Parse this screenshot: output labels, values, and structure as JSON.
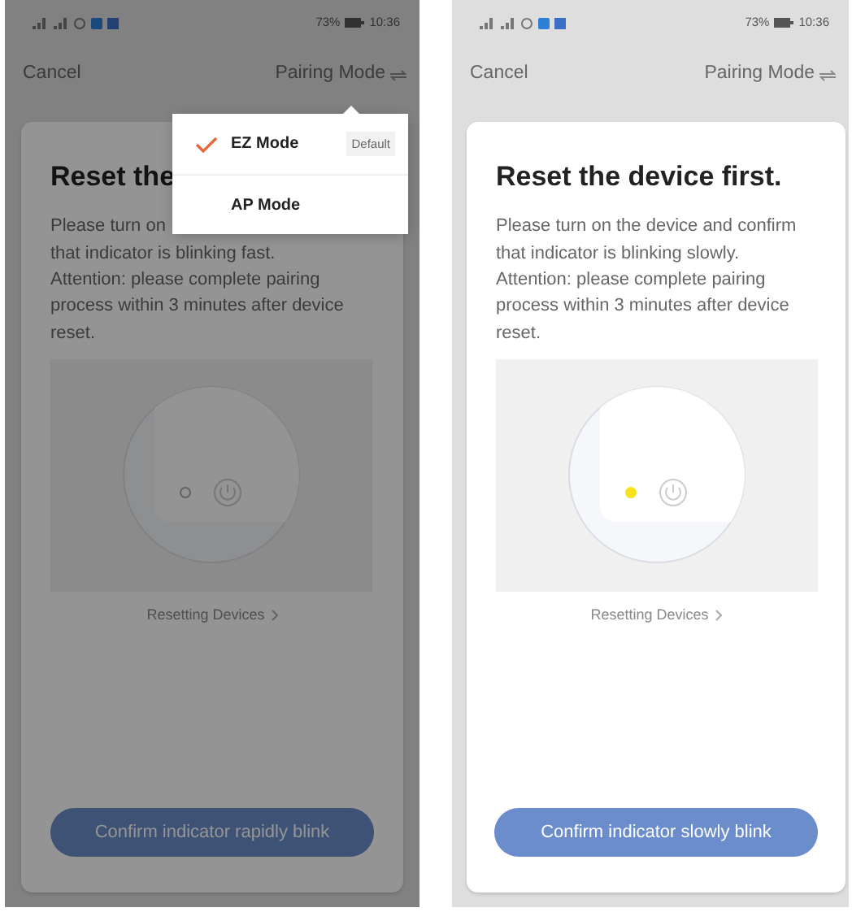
{
  "screens": [
    {
      "dimmed": true,
      "status_bar": {
        "battery": "73%",
        "time": "10:36"
      },
      "header": {
        "cancel": "Cancel",
        "pairing_mode": "Pairing Mode"
      },
      "card": {
        "title": "Reset the",
        "description_lines": [
          "Please turn on",
          "that indicator is blinking fast.",
          "Attention: please complete pairing",
          "process within 3 minutes after device",
          "reset."
        ],
        "indicator_lit": false,
        "link": "Resetting Devices",
        "button": "Confirm indicator rapidly blink"
      },
      "menu": {
        "items": [
          {
            "label": "EZ Mode",
            "selected": true,
            "badge": "Default"
          },
          {
            "label": "AP Mode",
            "selected": false
          }
        ]
      }
    },
    {
      "status_bar": {
        "battery": "73%",
        "time": "10:36"
      },
      "header": {
        "cancel": "Cancel",
        "pairing_mode": "Pairing Mode"
      },
      "card": {
        "title": "Reset the device first.",
        "description_lines": [
          "Please turn on the device and confirm",
          "that indicator is blinking slowly.",
          "Attention: please complete pairing",
          "process within 3 minutes after device",
          "reset."
        ],
        "indicator_lit": true,
        "link": "Resetting Devices",
        "button": "Confirm indicator slowly blink"
      }
    }
  ]
}
